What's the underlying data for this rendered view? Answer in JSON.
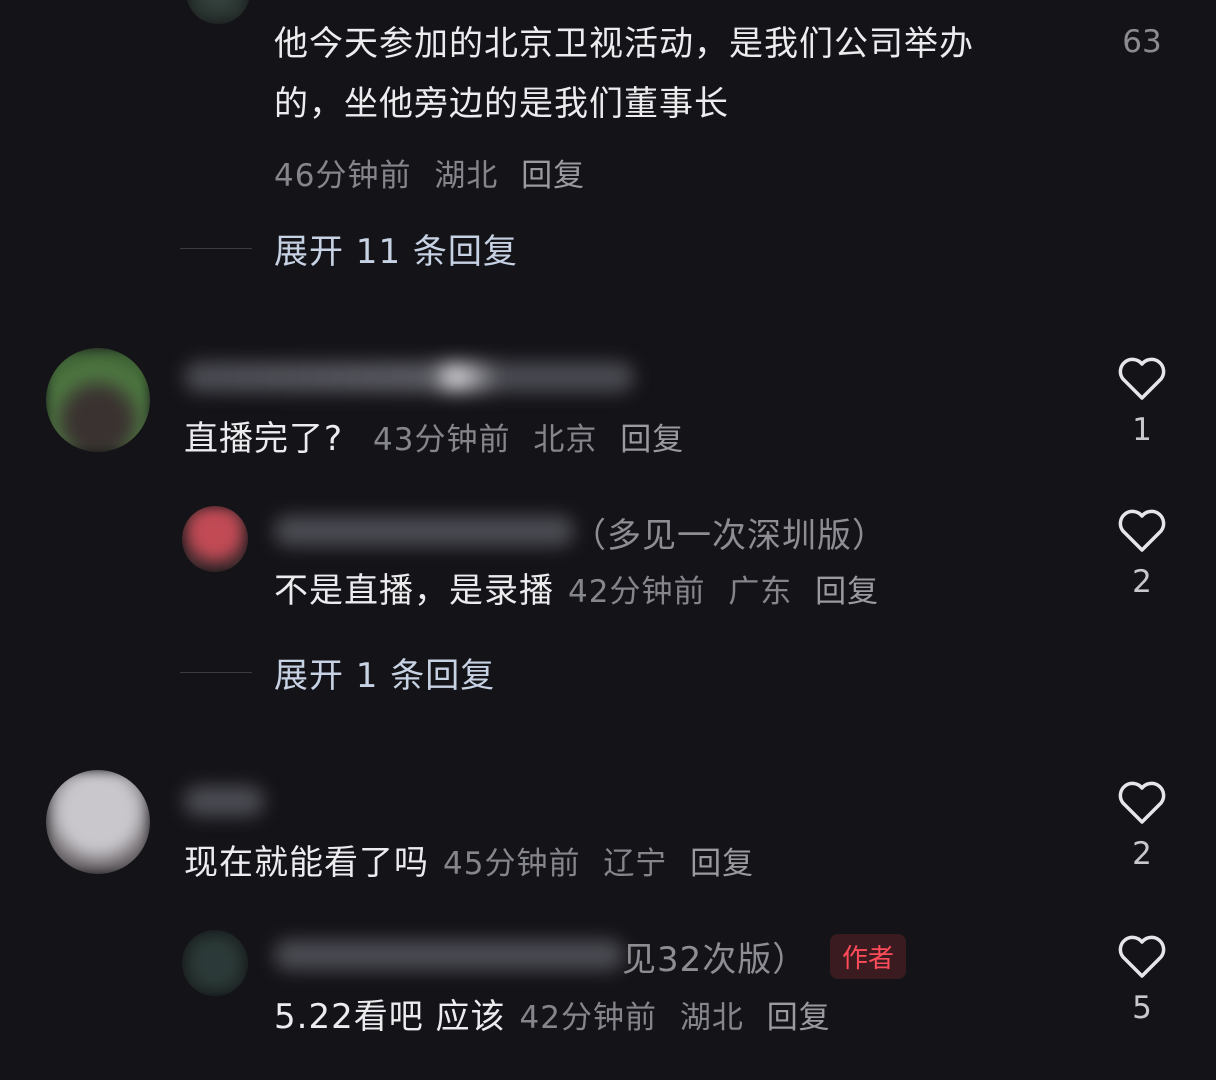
{
  "comments": [
    {
      "text_line1": "他今天参加的北京卫视活动，是我们公司举办",
      "text_line2": "的，坐他旁边的是我们董事长",
      "time": "46分钟前",
      "location": "湖北",
      "reply_label": "回复",
      "likes": "63",
      "expand_label": "展开 11 条回复"
    },
    {
      "text": "直播完了?",
      "time": "43分钟前",
      "location": "北京",
      "reply_label": "回复",
      "likes": "1",
      "sub_reply": {
        "name_tail": "（多见一次深圳版）",
        "text": "不是直播，是录播",
        "time": "42分钟前",
        "location": "广东",
        "reply_label": "回复",
        "likes": "2"
      },
      "expand_label": "展开 1 条回复"
    },
    {
      "text": "现在就能看了吗",
      "time": "45分钟前",
      "location": "辽宁",
      "reply_label": "回复",
      "likes": "2",
      "sub_reply": {
        "name_tail": "见32次版）",
        "badge": "作者",
        "text": "5.22看吧 应该",
        "time": "42分钟前",
        "location": "湖北",
        "reply_label": "回复",
        "likes": "5"
      }
    }
  ],
  "icons": {
    "like": "heart-outline-icon"
  },
  "colors": {
    "background": "#141418",
    "author_badge": "#ff4b5a",
    "expand_text": "#c7d2e4"
  }
}
